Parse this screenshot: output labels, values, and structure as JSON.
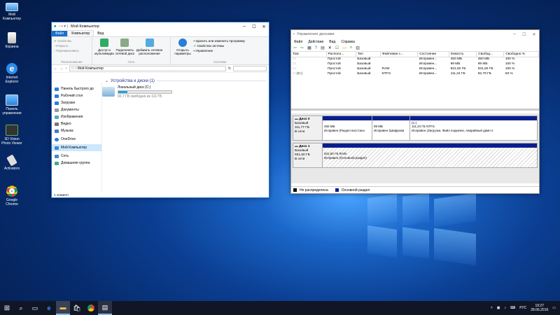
{
  "desktop": {
    "icons": [
      {
        "label": "Мой Компьютер",
        "name": "my-computer"
      },
      {
        "label": "Корзина",
        "name": "recycle-bin"
      },
      {
        "label": "Internet Explorer",
        "name": "internet-explorer"
      },
      {
        "label": "Панель управления",
        "name": "control-panel"
      },
      {
        "label": "3D Vision Photo Viewer",
        "name": "3d-vision"
      },
      {
        "label": "Activators",
        "name": "activators"
      },
      {
        "label": "Google Chrome",
        "name": "chrome"
      }
    ]
  },
  "explorer": {
    "title": "Мой Компьютер",
    "tabs": {
      "file": "Файл",
      "computer": "Компьютер",
      "view": "Вид"
    },
    "ribbon": {
      "properties": "Свойства",
      "open": "Открыть",
      "rename": "Переименовать",
      "group_location": "Расположение",
      "media_access": "Доступ к мультимедиа",
      "map_drive": "Подключить сетевой диск",
      "add_location": "Добавить сетевое расположение",
      "group_network": "Сеть",
      "open_settings": "Открыть параметры",
      "uninstall": "Удалить или изменить программу",
      "system_props": "Свойства системы",
      "manage": "Управление",
      "group_system": "Система"
    },
    "address": "Мой Компьютер",
    "nav": [
      "Панель быстрого до",
      "Рабочий стол",
      "Загрузки",
      "Документы",
      "Изображения",
      "Видео",
      "Музыка",
      "OneDrive",
      "Мой Компьютер",
      "Сеть",
      "Домашняя группа"
    ],
    "section_title": "Устройства и диски (1)",
    "drive_name": "Локальный диск (C:)",
    "drive_free": "92,7 ГБ свободно из 111 ГБ",
    "drive_used_fraction": 0.17,
    "status": "1 элемент"
  },
  "diskmgmt": {
    "title": "Управление дисками",
    "menu": [
      "Файл",
      "Действие",
      "Вид",
      "Справка"
    ],
    "columns": [
      "Том",
      "Располо...",
      "Тип",
      "Файловая с...",
      "Состояние",
      "Емкость",
      "Свобод...",
      "Свободно %"
    ],
    "rows": [
      [
        "",
        "Простой",
        "Базовый",
        "",
        "Исправен...",
        "450 МБ",
        "450 МБ",
        "100 %"
      ],
      [
        "",
        "Простой",
        "Базовый",
        "",
        "Исправен...",
        "99 МБ",
        "99 МБ",
        "100 %"
      ],
      [
        "",
        "Простой",
        "Базовый",
        "RAW",
        "Исправен...",
        "931,50 ГБ",
        "931,50 ГБ",
        "100 %"
      ],
      [
        "(C:)",
        "Простой",
        "Базовый",
        "NTFS",
        "Исправен...",
        "111,24 ГБ",
        "92,79 ГБ",
        "83 %"
      ]
    ],
    "disk0": {
      "name": "Диск 0",
      "type": "Базовый",
      "size": "111,77 ГБ",
      "state": "В сети",
      "parts": [
        {
          "size": "450 МБ",
          "status": "Исправен (Раздел восстано"
        },
        {
          "size": "99 МБ",
          "status": "Исправен (Шифрова"
        },
        {
          "label": "(C:)",
          "size": "111,24 ГБ NTFS",
          "status": "Исправен (Загрузка, Файл подкачки, Аварийный дамп п"
        }
      ]
    },
    "disk1": {
      "name": "Диск 1",
      "type": "Базовый",
      "size": "931,50 ГБ",
      "state": "В сети",
      "parts": [
        {
          "size": "931,50 ГБ RAW",
          "status": "Исправен (Основной раздел)"
        }
      ]
    },
    "legend": [
      "Не распределена",
      "Основной раздел"
    ]
  },
  "taskbar": {
    "lang": "РУС",
    "time": "19:27",
    "date": "28.06.2016"
  }
}
